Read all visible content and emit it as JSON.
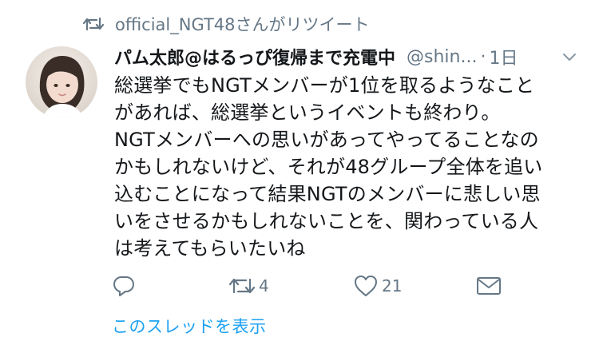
{
  "retweet_banner": {
    "icon": "retweet-icon",
    "text": "official_NGT48さんがリツイート"
  },
  "tweet": {
    "author_name": "パム太郎@はるっぴ復帰まで充電中",
    "handle": "@shin...",
    "separator": "·",
    "time": "1日",
    "body_lines": [
      "総選挙でもNGTメンバーが1位を取るようなこと",
      "があれば、総選挙というイベントも終わり。",
      "NGTメンバーへの思いがあってやってることなの",
      "かもしれないけど、それが48グループ全体を追い",
      "込むことになって結果NGTのメンバーに悲しい思",
      "いをさせるかもしれないことを、関わっている人",
      "は考えてもらいたいね"
    ],
    "actions": {
      "reply": {
        "icon": "reply-icon",
        "count": ""
      },
      "retweet": {
        "icon": "retweet-icon",
        "count": "4"
      },
      "like": {
        "icon": "heart-icon",
        "count": "21"
      },
      "dm": {
        "icon": "envelope-icon",
        "count": ""
      }
    },
    "thread_link": "このスレッドを表示"
  },
  "colors": {
    "text": "#14171a",
    "secondary": "#657786",
    "link": "#1da1f2",
    "background": "#ffffff"
  }
}
